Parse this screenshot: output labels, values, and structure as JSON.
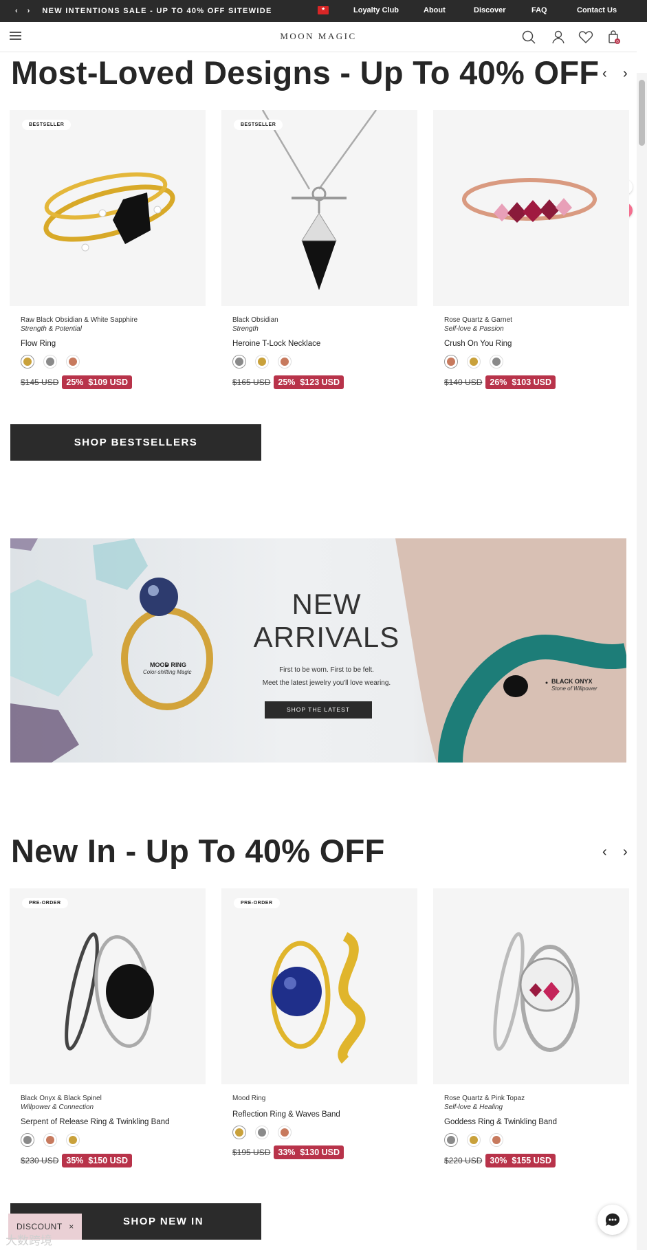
{
  "topbar": {
    "promo": "NEW INTENTIONS SALE - UP TO 40% OFF SITEWIDE",
    "prev_icon": "chevron-left-icon",
    "next_icon": "chevron-right-icon",
    "links": [
      "Loyalty Club",
      "About",
      "Discover",
      "FAQ",
      "Contact Us"
    ]
  },
  "header": {
    "logo": "MOON MAGIC",
    "icons": [
      "menu-icon",
      "search-icon",
      "account-icon",
      "heart-icon",
      "cart-icon"
    ],
    "cart_count": "0"
  },
  "bestsellers": {
    "title": "Most-Loved Designs - Up To 40% OFF",
    "cta": "SHOP BESTSELLERS",
    "products": [
      {
        "badge": "BESTSELLER",
        "stone": "Raw Black Obsidian & White Sapphire",
        "meaning": "Strength & Potential",
        "name": "Flow Ring",
        "swatches": [
          "#c9a13b",
          "#8a8a8a",
          "#c77a5e"
        ],
        "selected": 0,
        "orig": "$145 USD",
        "discount": "25%",
        "sale": "$109 USD"
      },
      {
        "badge": "BESTSELLER",
        "stone": "Black Obsidian",
        "meaning": "Strength",
        "name": "Heroine T-Lock Necklace",
        "swatches": [
          "#8a8a8a",
          "#c9a13b",
          "#c77a5e"
        ],
        "selected": 0,
        "orig": "$165 USD",
        "discount": "25%",
        "sale": "$123 USD"
      },
      {
        "badge": "",
        "stone": "Rose Quartz & Garnet",
        "meaning": "Self-love & Passion",
        "name": "Crush On You Ring",
        "swatches": [
          "#c77a5e",
          "#c9a13b",
          "#8a8a8a"
        ],
        "selected": 0,
        "orig": "$140 USD",
        "discount": "26%",
        "sale": "$103 USD"
      }
    ]
  },
  "banner": {
    "title_line1": "NEW",
    "title_line2": "ARRIVALS",
    "sub_line1": "First to be worn.  First to be felt.",
    "sub_line2": "Meet the latest jewelry you'll love wearing.",
    "button": "SHOP THE LATEST",
    "label1_title": "MOOD RING",
    "label1_sub": "Color-shifting Magic",
    "label2_title": "BLACK ONYX",
    "label2_sub": "Stone of Willpower"
  },
  "newin": {
    "title": "New In - Up To 40% OFF",
    "cta": "SHOP NEW IN",
    "products": [
      {
        "badge": "PRE-ORDER",
        "stone": "Black Onyx & Black Spinel",
        "meaning": "Willpower & Connection",
        "name": "Serpent of Release Ring & Twinkling Band",
        "swatches": [
          "#8a8a8a",
          "#c77a5e",
          "#c9a13b"
        ],
        "selected": 0,
        "orig": "$230 USD",
        "discount": "35%",
        "sale": "$150 USD"
      },
      {
        "badge": "PRE-ORDER",
        "stone": "Mood Ring",
        "meaning": "",
        "name": "Reflection Ring & Waves Band",
        "swatches": [
          "#c9a13b",
          "#8a8a8a",
          "#c77a5e"
        ],
        "selected": 0,
        "orig": "$195 USD",
        "discount": "33%",
        "sale": "$130 USD"
      },
      {
        "badge": "",
        "stone": "Rose Quartz & Pink Topaz",
        "meaning": "Self-love & Healing",
        "name": "Goddess Ring & Twinkling Band",
        "swatches": [
          "#8a8a8a",
          "#c9a13b",
          "#c77a5e"
        ],
        "selected": 0,
        "orig": "$220 USD",
        "discount": "30%",
        "sale": "$155 USD"
      }
    ]
  },
  "discount_tab": "DISCOUNT",
  "close_glyph": "×",
  "watermark": "大数跨境",
  "chat_icon": "chat-icon"
}
